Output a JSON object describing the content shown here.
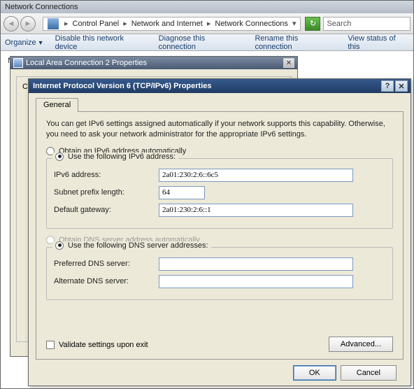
{
  "parent": {
    "title": "Network Connections",
    "breadcrumb": [
      "Control Panel",
      "Network and Internet",
      "Network Connections"
    ],
    "search_placeholder": "Search",
    "commands": {
      "organize": "Organize",
      "disable": "Disable this network device",
      "diagnose": "Diagnose this connection",
      "rename": "Rename this connection",
      "viewstatus": "View status of this"
    },
    "body_label": "Ne"
  },
  "small_window": {
    "title": "Local Area Connection 2 Properties",
    "side_label": "C"
  },
  "dialog": {
    "title": "Internet Protocol Version 6 (TCP/IPv6) Properties",
    "tab": "General",
    "description": "You can get IPv6 settings assigned automatically if your network supports this capability. Otherwise, you need to ask your network administrator for the appropriate IPv6 settings.",
    "addr_auto": "Obtain an IPv6 address automatically",
    "addr_manual": "Use the following IPv6 address:",
    "ipv6_label": "IPv6 address:",
    "ipv6_value": "2a01:230:2:6::6c5",
    "prefix_label": "Subnet prefix length:",
    "prefix_value": "64",
    "gateway_label": "Default gateway:",
    "gateway_value": "2a01:230:2:6::1",
    "dns_auto": "Obtain DNS server address automatically",
    "dns_manual": "Use the following DNS server addresses:",
    "pref_dns_label": "Preferred DNS server:",
    "pref_dns_value": "",
    "alt_dns_label": "Alternate DNS server:",
    "alt_dns_value": "",
    "validate": "Validate settings upon exit",
    "advanced": "Advanced...",
    "ok": "OK",
    "cancel": "Cancel"
  }
}
